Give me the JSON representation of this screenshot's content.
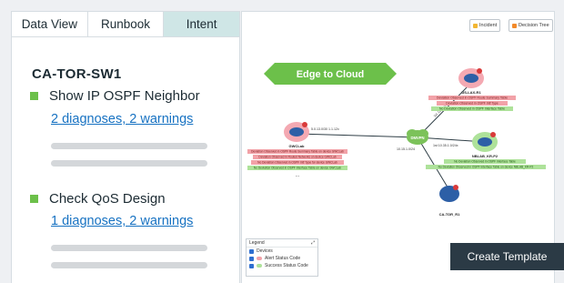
{
  "tabs": [
    {
      "label": "Data View"
    },
    {
      "label": "Runbook"
    },
    {
      "label": "Intent"
    }
  ],
  "device": "CA-TOR-SW1",
  "items": [
    {
      "title": "Show IP OSPF Neighbor",
      "link": "2 diagnoses, 2 warnings"
    },
    {
      "title": "Check QoS Design",
      "link": "1 diagnoses, 2 warnings"
    }
  ],
  "toolbar": {
    "incident": "Incident",
    "decision_tree": "Decision Tree"
  },
  "banner": "Edge to Cloud",
  "nodes": {
    "left": {
      "label": "GWCLab"
    },
    "top": {
      "label": "US-LAX-R1"
    },
    "hub": {
      "label": "DMVPN"
    },
    "mid": {
      "label": "NBLAB_KR-P2"
    },
    "bottom": {
      "label": "CA-TOR_R1"
    }
  },
  "link_labels": {
    "left_hub": "5.0.13.0/30 1.1.12x",
    "hub_top": "1st 12.11.1.0x",
    "hub_mid": "1st 10.35.1.0/24x",
    "hub_bottom": "10.15.1.0/24"
  },
  "annotations": {
    "top": [
      "Deviation Observed in OSPF Route Summary Table",
      "Deviation Observed in OSPF Intf Type",
      "No Deviation Observed in OSPF Interface Table"
    ],
    "left": [
      "Deviation Observed in OSPF Route Summary Table on device GWCLab",
      "Deviation Observed in Routed Networks on device GWCLab",
      "No Deviation Observed in OSPF Intf Type for device GWCLab",
      "No Deviation Observed in OSPF Interface Table on device GWCLab",
      "..."
    ],
    "mid": [
      "No Deviation Observed in OSPF Interface Table",
      "No Deviation Observed in OSPF Interface Table on device NBLAB_KR-P2"
    ]
  },
  "legend": {
    "title": "Legend",
    "rows": [
      {
        "label": "Devices"
      },
      {
        "label": "Alert Status Code"
      },
      {
        "label": "Success Status Code"
      }
    ]
  },
  "colors": {
    "accent_tab": "#cfe6e6",
    "bullet": "#6cc04a",
    "link": "#1772c2",
    "banner": "#6cc04a",
    "create_bg": "#2b3a45",
    "alert": "#f2a2a8",
    "success": "#aee29a"
  },
  "create_template": "Create Template"
}
